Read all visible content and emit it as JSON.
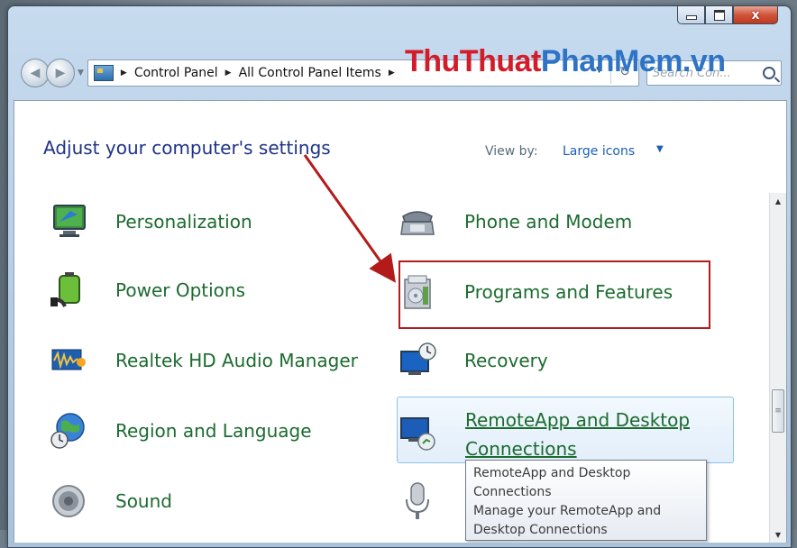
{
  "window": {
    "caption": {
      "close_glyph": "x"
    }
  },
  "navigation": {
    "breadcrumb": [
      "Control Panel",
      "All Control Panel Items"
    ],
    "search_placeholder": "Search Con..."
  },
  "watermark": {
    "part1": "ThuThuat",
    "part2": "PhanMem.vn"
  },
  "main": {
    "heading": "Adjust your computer's settings",
    "view_by_label": "View by:",
    "view_by_value": "Large icons"
  },
  "items": {
    "personalization": "Personalization",
    "phone_modem": "Phone and Modem",
    "power_options": "Power Options",
    "programs_features": "Programs and Features",
    "realtek": "Realtek HD Audio Manager",
    "recovery": "Recovery",
    "region_language": "Region and Language",
    "remoteapp_line1": "RemoteApp and Desktop",
    "remoteapp_line2": "Connections",
    "sound": "Sound"
  },
  "tooltip": {
    "line1": "RemoteApp and Desktop",
    "line2": "Connections",
    "line3": "Manage your RemoteApp and",
    "line4": "Desktop Connections"
  },
  "colors": {
    "item_link": "#1b6b2f",
    "heading": "#1e3287",
    "highlight_border": "#b31b1b",
    "annotation_arrow": "#b31b1b"
  },
  "icons": {
    "personalization": "monitor-paint-icon",
    "phone_modem": "telephone-icon",
    "power_options": "battery-plug-icon",
    "programs_features": "programs-box-icon",
    "realtek": "audio-wave-icon",
    "recovery": "recovery-monitor-icon",
    "region_language": "globe-clock-icon",
    "remoteapp": "remote-desktop-icon",
    "sound": "speaker-icon",
    "microphone": "microphone-icon"
  }
}
